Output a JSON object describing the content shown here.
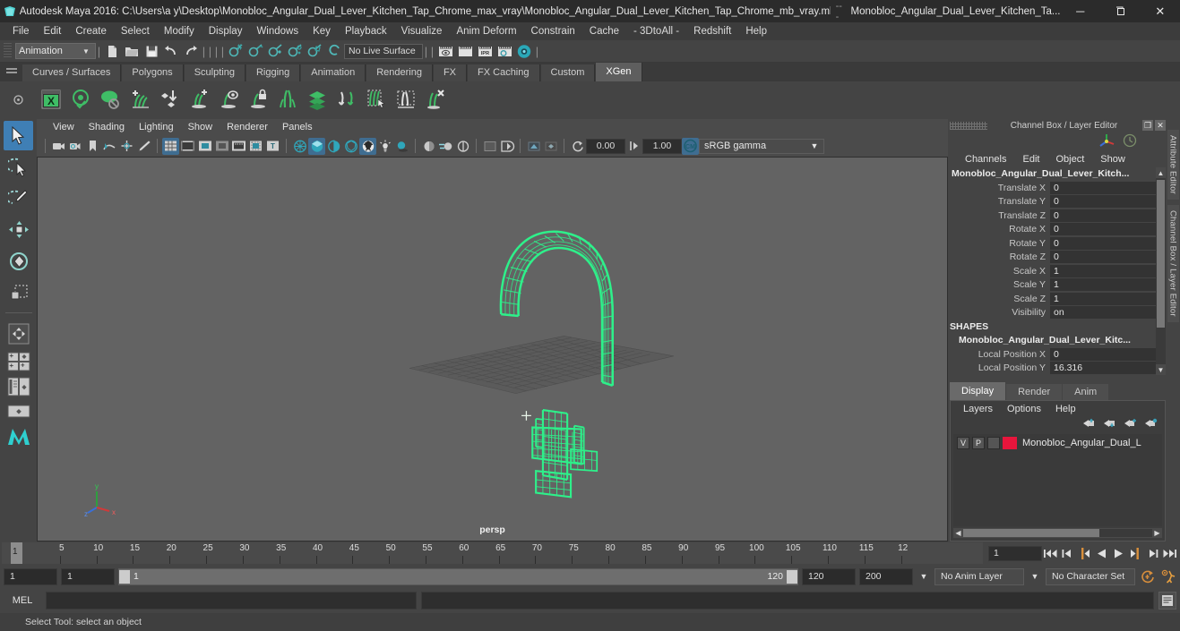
{
  "titlebar": {
    "app_title": "Autodesk Maya 2016: C:\\Users\\a y\\Desktop\\Monobloc_Angular_Dual_Lever_Kitchen_Tap_Chrome_max_vray\\Monobloc_Angular_Dual_Lever_Kitchen_Tap_Chrome_mb_vray.mb*",
    "separator": "---",
    "doc_title": "Monobloc_Angular_Dual_Lever_Kitchen_Ta...",
    "minimize": "─",
    "maximize": "❐",
    "close": "✕"
  },
  "menubar": {
    "items": [
      "File",
      "Edit",
      "Create",
      "Select",
      "Modify",
      "Display",
      "Windows",
      "Key",
      "Playback",
      "Visualize",
      "Anim Deform",
      "Constrain",
      "Cache",
      "- 3DtoAll -",
      "Redshift",
      "Help"
    ]
  },
  "statusline": {
    "mode": "Animation",
    "mode_arrow": "▼",
    "live_surface": "No Live Surface",
    "icons": [
      "new-scene-icon",
      "open-scene-icon",
      "save-scene-icon",
      "undo-icon",
      "redo-icon",
      "select-by-hierarchy-icon",
      "select-by-object-icon",
      "select-by-component-icon",
      "snap-to-grid-icon",
      "snap-to-curve-icon",
      "snap-to-point-icon",
      "snap-to-projected-center-icon",
      "snap-to-view-plane-icon",
      "make-live-icon",
      "render-view-icon",
      "render-current-frame-icon",
      "ipr-render-icon",
      "render-settings-icon",
      "hypershade-icon"
    ]
  },
  "shelf": {
    "tabs": [
      "Curves / Surfaces",
      "Polygons",
      "Sculpting",
      "Rigging",
      "Animation",
      "Rendering",
      "FX",
      "FX Caching",
      "Custom",
      "XGen"
    ],
    "active_tab": "XGen",
    "icons": [
      "xgen-editor-icon",
      "xgen-preview-icon",
      "xgen-disable-preview-icon",
      "xgen-add-description-icon",
      "xgen-import-collection-icon",
      "xgen-add-guide-icon",
      "xgen-guide-visibility-icon",
      "xgen-lock-guide-icon",
      "xgen-sculpt-guide-icon",
      "xgen-layers-icon",
      "xgen-groom-icon",
      "xgen-select-primitives-icon",
      "xgen-region-mask-icon",
      "xgen-delete-primitives-icon"
    ]
  },
  "toolbox": {
    "items": [
      "select-tool",
      "lasso-select-tool",
      "paint-select-tool",
      "move-tool",
      "rotate-tool",
      "scale-tool",
      "last-tool-used",
      "four-view-layout",
      "two-panes-layout",
      "persp-outliner-layout",
      "hypergraph-layout",
      "single-perspective-layout"
    ],
    "active": "select-tool"
  },
  "viewport": {
    "menu": [
      "View",
      "Shading",
      "Lighting",
      "Show",
      "Renderer",
      "Panels"
    ],
    "exposure_value": "0.00",
    "gamma_value": "1.00",
    "color_management": "sRGB gamma",
    "dropdown_arrow": "▼",
    "camera_label": "persp",
    "wireframe_color": "#2ef08a",
    "background_color": "#636363",
    "axis_labels": [
      "x",
      "y",
      "z"
    ],
    "toolbar_icons": [
      "select-camera-icon",
      "camera-attributes-icon",
      "bookmark-icon",
      "image-plane-icon",
      "2d-pan-zoom-icon",
      "grease-pencil-icon",
      "grid-icon",
      "film-gate-icon",
      "resolution-gate-icon",
      "gate-mask-icon",
      "film-origin-icon",
      "safe-action-icon",
      "safe-title-icon",
      "wireframe-icon",
      "smooth-shade-icon",
      "smooth-shade-textured-icon",
      "flat-shade-icon",
      "wireframe-on-shaded-icon",
      "use-default-light-icon",
      "shadows-icon",
      "screen-space-ao-icon",
      "motion-blur-icon",
      "multisample-icon",
      "isolate-select-icon",
      "xray-icon",
      "xray-joints-icon",
      "xray-active-components-icon",
      "exposure-icon",
      "gamma-icon",
      "color-management-icon"
    ]
  },
  "channelbox": {
    "title": "Channel Box / Layer Editor",
    "undock": "❐",
    "close": "✕",
    "menu": [
      "Channels",
      "Edit",
      "Object",
      "Show"
    ],
    "object_name": "Monobloc_Angular_Dual_Lever_Kitch...",
    "attributes": [
      {
        "name": "Translate X",
        "value": "0"
      },
      {
        "name": "Translate Y",
        "value": "0"
      },
      {
        "name": "Translate Z",
        "value": "0"
      },
      {
        "name": "Rotate X",
        "value": "0"
      },
      {
        "name": "Rotate Y",
        "value": "0"
      },
      {
        "name": "Rotate Z",
        "value": "0"
      },
      {
        "name": "Scale X",
        "value": "1"
      },
      {
        "name": "Scale Y",
        "value": "1"
      },
      {
        "name": "Scale Z",
        "value": "1"
      },
      {
        "name": "Visibility",
        "value": "on"
      }
    ],
    "shapes_header": "SHAPES",
    "shape_name": "Monobloc_Angular_Dual_Lever_Kitc...",
    "shape_attributes": [
      {
        "name": "Local Position X",
        "value": "0"
      },
      {
        "name": "Local Position Y",
        "value": "16.316"
      }
    ],
    "scroll_up": "▲",
    "scroll_down": "▼"
  },
  "layereditor": {
    "tabs": [
      "Display",
      "Render",
      "Anim"
    ],
    "active_tab": "Display",
    "menu": [
      "Layers",
      "Options",
      "Help"
    ],
    "buttons": [
      "move-layer-up-icon",
      "move-layer-down-icon",
      "create-new-layer-icon",
      "create-layer-from-selected-icon"
    ],
    "layers": [
      {
        "visibility": "V",
        "playback": "P",
        "type": "",
        "color": "#e8153c",
        "name": "Monobloc_Angular_Dual_L"
      }
    ],
    "scroll_left": "◀",
    "scroll_right": "▶"
  },
  "dockstrip": {
    "labels": [
      "Attribute Editor",
      "Channel Box / Layer Editor"
    ]
  },
  "timeline": {
    "tick_labels": [
      "5",
      "10",
      "15",
      "20",
      "25",
      "30",
      "35",
      "40",
      "45",
      "50",
      "55",
      "60",
      "65",
      "70",
      "75",
      "80",
      "85",
      "90",
      "95",
      "100",
      "105",
      "110",
      "115",
      "12"
    ],
    "current_frame": "1",
    "frame_field": "1",
    "playback_buttons": [
      "go-to-start-icon",
      "step-back-keyframe-icon",
      "step-back-frame-icon",
      "play-backwards-icon",
      "play-forwards-icon",
      "step-forward-frame-icon",
      "step-forward-keyframe-icon",
      "go-to-end-icon"
    ]
  },
  "rangeslider": {
    "anim_start": "1",
    "range_start": "1",
    "bar_start": "1",
    "bar_end": "120",
    "range_end": "120",
    "anim_end": "200",
    "anim_layer": "No Anim Layer",
    "character_set": "No Character Set",
    "arrow": "▼",
    "buttons": [
      "auto-keyframe-icon",
      "animation-preferences-icon"
    ]
  },
  "commandline": {
    "label": "MEL",
    "input_value": "",
    "output_value": "",
    "script_editor_button": "script-editor-icon"
  },
  "statusbar": {
    "help_text": "Select Tool: select an object"
  }
}
